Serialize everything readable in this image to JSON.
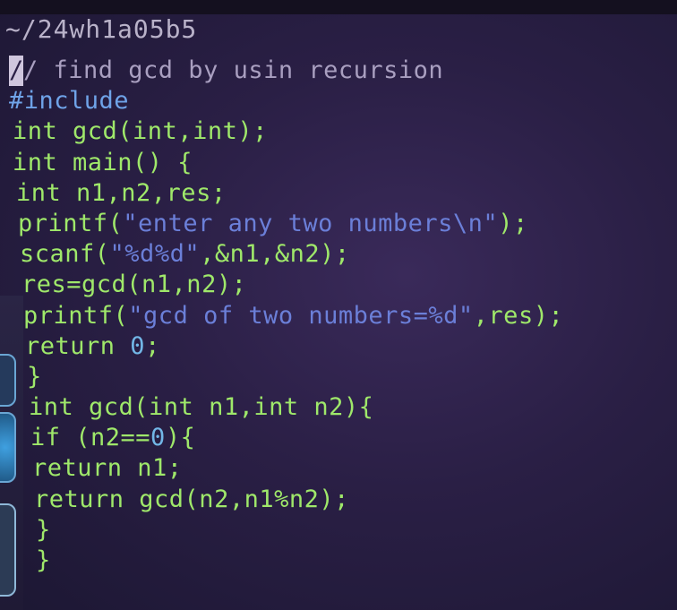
{
  "title": "~/24wh1a05b5",
  "cursor_char": "/",
  "code_lines": [
    {
      "segments": [
        {
          "cls": "comment",
          "text": "/ find gcd by usin recursion"
        }
      ]
    },
    {
      "segments": [
        {
          "cls": "preproc",
          "text": "#include"
        }
      ]
    },
    {
      "segments": [
        {
          "cls": "green",
          "text": "int gcd(int,int);"
        }
      ]
    },
    {
      "segments": [
        {
          "cls": "green",
          "text": "int main() {"
        }
      ]
    },
    {
      "segments": [
        {
          "cls": "green",
          "text": "int n1,n2,res;"
        }
      ]
    },
    {
      "segments": [
        {
          "cls": "green",
          "text": "printf("
        },
        {
          "cls": "str",
          "text": "\"enter any two numbers\\n\""
        },
        {
          "cls": "green",
          "text": ");"
        }
      ]
    },
    {
      "segments": [
        {
          "cls": "green",
          "text": "scanf("
        },
        {
          "cls": "str",
          "text": "\"%d%d\""
        },
        {
          "cls": "green",
          "text": ",&n1,&n2);"
        }
      ]
    },
    {
      "segments": [
        {
          "cls": "green",
          "text": "res=gcd(n1,n2);"
        }
      ]
    },
    {
      "segments": [
        {
          "cls": "green",
          "text": "printf("
        },
        {
          "cls": "str",
          "text": "\"gcd of two numbers=%d\""
        },
        {
          "cls": "green",
          "text": ",res);"
        }
      ]
    },
    {
      "segments": [
        {
          "cls": "green",
          "text": "return "
        },
        {
          "cls": "num",
          "text": "0"
        },
        {
          "cls": "green",
          "text": ";"
        }
      ]
    },
    {
      "segments": [
        {
          "cls": "green",
          "text": "}"
        }
      ]
    },
    {
      "segments": [
        {
          "cls": "green",
          "text": "int gcd(int n1,int n2){"
        }
      ]
    },
    {
      "segments": [
        {
          "cls": "green",
          "text": "if (n2=="
        },
        {
          "cls": "num",
          "text": "0"
        },
        {
          "cls": "green",
          "text": "){"
        }
      ]
    },
    {
      "segments": [
        {
          "cls": "green",
          "text": "return n1;"
        }
      ]
    },
    {
      "segments": [
        {
          "cls": "green",
          "text": "return gcd(n2,n1%n2);"
        }
      ]
    },
    {
      "segments": [
        {
          "cls": "green",
          "text": "}"
        }
      ]
    },
    {
      "segments": [
        {
          "cls": "green",
          "text": "}"
        }
      ]
    }
  ],
  "colors": {
    "code_green": "#9fe86a",
    "string_blue": "#6b7fd8",
    "comment": "#a99fc0",
    "preproc": "#6fa3e8",
    "background": "#2a1f45"
  },
  "dock_icons": [
    "app-icon",
    "browser-icon",
    "files-icon"
  ]
}
